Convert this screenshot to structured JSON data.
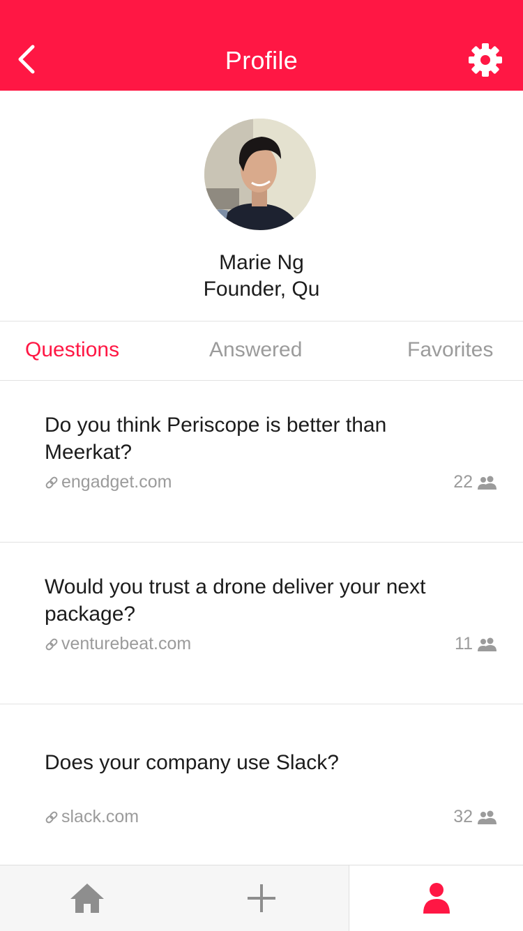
{
  "header": {
    "title": "Profile",
    "back_icon": "chevron-left-icon",
    "settings_icon": "gear-icon",
    "color": "#ff1744"
  },
  "profile": {
    "name": "Marie Ng",
    "role": "Founder, Qu"
  },
  "tabs": [
    {
      "label": "Questions",
      "active": true
    },
    {
      "label": "Answered",
      "active": false
    },
    {
      "label": "Favorites",
      "active": false
    }
  ],
  "questions": [
    {
      "text": "Do you think Periscope is better than Meerkat?",
      "source": "engadget.com",
      "count": "22"
    },
    {
      "text": "Would you trust a drone deliver your next package?",
      "source": "venturebeat.com",
      "count": "11"
    },
    {
      "text": "Does your company use Slack?",
      "source": "slack.com",
      "count": "32"
    }
  ],
  "tabbar": {
    "items": [
      {
        "icon": "home-icon",
        "active": false
      },
      {
        "icon": "plus-icon",
        "active": false
      },
      {
        "icon": "person-icon",
        "active": true
      }
    ],
    "active_color": "#ff1744",
    "inactive_color": "#8e8e8e"
  }
}
